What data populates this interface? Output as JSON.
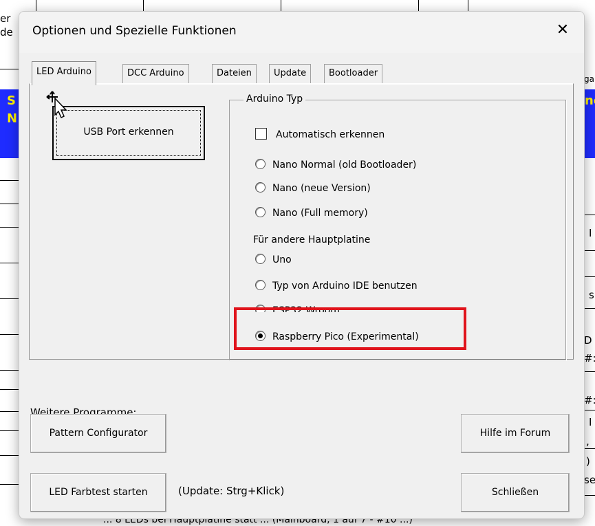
{
  "background": {
    "left_fragments": [
      "er",
      "de"
    ],
    "blue_fragments": [
      "S",
      "N"
    ],
    "right_fragments": [
      "ga",
      "nc",
      "I",
      "s",
      "D",
      "#:",
      "#:",
      "I",
      ",",
      ")",
      "se"
    ],
    "bottom_text": "... 8 LEDs bei Hauptplatine statt ...   (Mainboard, 1 auf 7 - #10 ...)"
  },
  "dialog": {
    "title": "Optionen und Spezielle Funktionen",
    "close_glyph": "✕"
  },
  "tabs": [
    {
      "label": "LED Arduino",
      "active": true
    },
    {
      "label": "DCC Arduino",
      "active": false
    },
    {
      "label": "Dateien",
      "active": false
    },
    {
      "label": "Update",
      "active": false
    },
    {
      "label": "Bootloader",
      "active": false
    }
  ],
  "usb_button": {
    "label": "USB Port erkennen"
  },
  "arduino_typ": {
    "title": "Arduino Typ",
    "auto_detect": {
      "label": "Automatisch erkennen",
      "checked": false
    },
    "options": [
      {
        "label": "Nano Normal (old Bootloader)",
        "selected": false
      },
      {
        "label": "Nano (neue Version)",
        "selected": false
      },
      {
        "label": "Nano (Full memory)",
        "selected": false
      }
    ],
    "other_boards_label": "Für andere Hauptplatine",
    "other_options": [
      {
        "label": "Uno",
        "selected": false
      },
      {
        "label": "Typ von Arduino IDE benutzen",
        "selected": false
      },
      {
        "label": "ESP32 Wroom",
        "selected": false
      },
      {
        "label": "Raspberry Pico (Experimental)",
        "selected": true
      }
    ],
    "highlight_color": "#e0141c"
  },
  "weitere": {
    "label": "Weitere Programme:",
    "pattern_button": "Pattern Configurator",
    "forum_button": "Hilfe im Forum",
    "farbtest_button": "LED Farbtest starten",
    "update_hint": "(Update: Strg+Klick)",
    "close_button": "Schließen"
  }
}
